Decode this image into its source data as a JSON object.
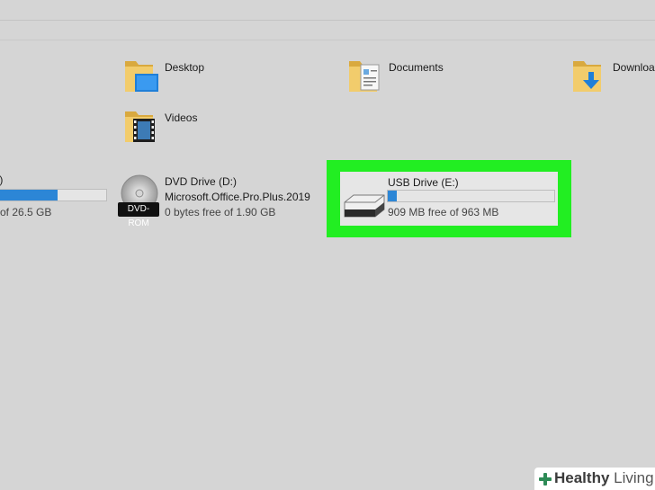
{
  "folders": [
    {
      "name": "Desktop"
    },
    {
      "name": "Documents"
    },
    {
      "name": "Downloa"
    },
    {
      "name": "Videos"
    }
  ],
  "drives": {
    "local": {
      "name_partial": ":)",
      "free_partial": "of 26.5 GB",
      "used_fraction": 0.55
    },
    "dvd": {
      "name": "DVD Drive (D:)",
      "volume": "Microsoft.Office.Pro.Plus.2019",
      "free": "0 bytes free of 1.90 GB",
      "badge": "DVD-ROM"
    },
    "usb": {
      "name": "USB Drive (E:)",
      "free": "909 MB free of 963 MB",
      "used_fraction": 0.056
    }
  },
  "watermark": {
    "brand_a": "Healthy",
    "brand_b": "Living"
  },
  "colors": {
    "highlight": "#22ee22",
    "bar_fill": "#2c86d6",
    "folder": "#e8c266"
  }
}
